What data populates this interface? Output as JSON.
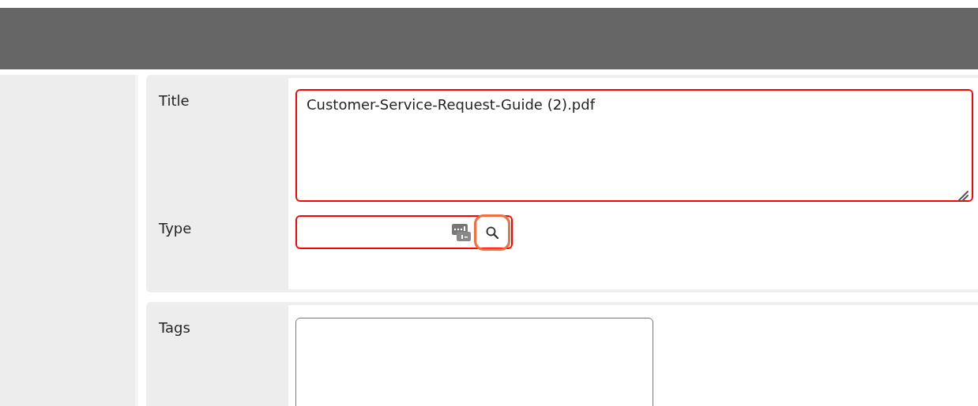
{
  "sections": [
    {
      "fields": [
        {
          "kind": "textarea",
          "label": "Title",
          "value": "Customer-Service-Request-Guide (2).pdf",
          "invalid": true
        },
        {
          "kind": "lookup",
          "label": "Type",
          "invalid": true,
          "search_highlighted": true
        }
      ]
    },
    {
      "fields": [
        {
          "kind": "tags",
          "label": "Tags",
          "invalid": false
        }
      ]
    }
  ]
}
